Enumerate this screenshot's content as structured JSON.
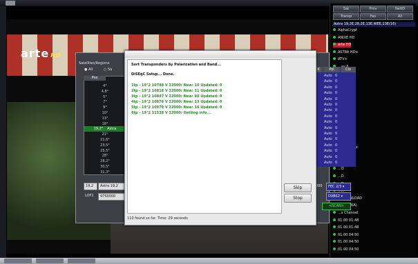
{
  "right_panel": {
    "buttons": [
      {
        "id": "sat",
        "label": "Sat"
      },
      {
        "id": "prov",
        "label": "Prov"
      },
      {
        "id": "netid",
        "label": "NetID"
      },
      {
        "id": "transp",
        "label": "Transp"
      },
      {
        "id": "fav",
        "label": "Fav"
      },
      {
        "id": "all",
        "label": "All"
      }
    ],
    "group_title": "Astra 19,2E,28,2E,13E,WEE,23E(16)",
    "channels": [
      {
        "label": "AlphaCrypt"
      },
      {
        "label": "ANIXE HD"
      },
      {
        "label": "arte HD",
        "selected": true
      },
      {
        "label": "ASTRA HD+"
      },
      {
        "label": "ATV+"
      },
      {
        "label": "...ay 6"
      },
      {
        "label": "...a 8"
      },
      {
        "label": "...ay HD"
      },
      {
        "label": "...d DC3"
      },
      {
        "label": "...ARTH"
      },
      {
        "label": "...C3"
      },
      {
        "label": "...CTV"
      },
      {
        "label": "...HD"
      },
      {
        "label": "...ur"
      },
      {
        "label": "...ov"
      },
      {
        "label": "...r Austria"
      },
      {
        "label": "...r Schweiz"
      },
      {
        "label": "...Austria"
      },
      {
        "label": "...D"
      },
      {
        "label": "...D"
      },
      {
        "label": "...D"
      },
      {
        "label": "...D"
      },
      {
        "label": "...H"
      },
      {
        "label": "...DOWNLOAD"
      },
      {
        "label": "...HD (SKA)"
      },
      {
        "label": "...s Channel"
      },
      {
        "label": "01.00 01:48"
      },
      {
        "label": "01.00 01:48"
      },
      {
        "label": "01.00 04:50"
      },
      {
        "label": "01.00 04:50"
      },
      {
        "label": "01.00 04:50"
      }
    ]
  },
  "video": {
    "channel_logo": "arte",
    "logo_suffix": "HD"
  },
  "satellites_window": {
    "title": "Satellites/Regions",
    "radio_all": "All",
    "radio_sat": "Sa",
    "list_header": "Pos",
    "positions": [
      "4°",
      "4,8°",
      "5°",
      "7°",
      "9°",
      "10°",
      "13°",
      "16°",
      "19,2°",
      "21°",
      "21,6°",
      "23,5°",
      "25,5°",
      "28°",
      "28,2°",
      "30,5°",
      "31,3°"
    ],
    "selected_index": 8,
    "selected_label": "Astra",
    "position_field": "19,2",
    "name_field": "Astra 19,2",
    "lof_label": "LOF1",
    "lof_value": "9750000",
    "table_headers": [
      "K",
      "Pol",
      "Clo"
    ],
    "table_rows": [
      [
        "Auto",
        "0"
      ],
      [
        "Auto",
        "0"
      ],
      [
        "Auto",
        "0"
      ],
      [
        "Auto",
        "0"
      ],
      [
        "Auto",
        "0"
      ],
      [
        "Auto",
        "0"
      ],
      [
        "Auto",
        "0"
      ],
      [
        "Auto",
        "0"
      ],
      [
        "Auto",
        "0"
      ],
      [
        "Auto",
        "0"
      ],
      [
        "Auto",
        "0"
      ],
      [
        "Auto",
        "0"
      ],
      [
        "Auto",
        "0"
      ],
      [
        "Auto",
        "0"
      ],
      [
        "Auto",
        "0"
      ],
      [
        "Auto",
        "0"
      ]
    ],
    "fec": "FEC 2/3",
    "modulation": "DVBS2",
    "scan_button": "<SCAN>",
    "freq_value": "000"
  },
  "dialog": {
    "lines": [
      {
        "text": "Sort Transponders by Polarization and Band...",
        "style": "head"
      },
      {
        "text": "DiSEqC Setup... Done.",
        "style": "head"
      },
      {
        "text": "1tp - 19°2 10788 V 22000: New: 10   Updated: 0",
        "style": "grn"
      },
      {
        "text": "2tp - 19°2 10818 V 22000: New: 11   Updated: 0",
        "style": "grn"
      },
      {
        "text": "3tp - 19°2 10847 V 22000: New: 60   Updated: 0",
        "style": "grn"
      },
      {
        "text": "4tp - 19°2 10876 V 22000: New: 13   Updated: 0",
        "style": "grn"
      },
      {
        "text": "5tp - 19°2 10979 V 22000: New: 16   Updated: 0",
        "style": "grn"
      },
      {
        "text": "6tp - 19°2 11538 V 22000: Getting info...",
        "style": "grn"
      }
    ],
    "skip_button": "Skip",
    "stop_button": "Stop",
    "status": "110 found so far. Time: 29 seconds"
  }
}
